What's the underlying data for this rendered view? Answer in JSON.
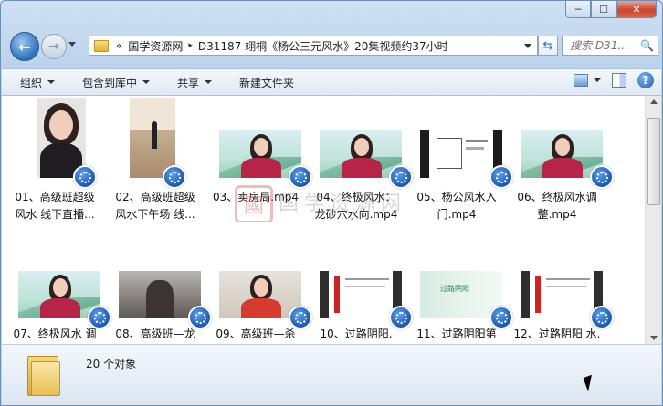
{
  "window": {
    "caption_buttons": {
      "minimize": "─",
      "maximize": "☐",
      "close": "✕"
    }
  },
  "nav": {
    "back_glyph": "←",
    "forward_glyph": "→",
    "breadcrumbs": [
      "«",
      "国学资源网",
      "▸",
      "D31187 翊桐《杨公三元风水》20集视频约37小时"
    ],
    "search_placeholder": "搜索 D31...",
    "search_glyph": "🔍",
    "refresh_glyph": "⇆"
  },
  "toolbar": {
    "organize": "组织",
    "include_library": "包含到库中",
    "share": "共享",
    "new_folder": "新建文件夹",
    "help": "?"
  },
  "files": [
    {
      "label": "01、高级班超级\n风水 线下直播...",
      "thumb": "portrait"
    },
    {
      "label": "02、高级班超级\n风水下午场 线...",
      "thumb": "room"
    },
    {
      "label": "03、卖房局.mp4",
      "thumb": "mountain"
    },
    {
      "label": "04、终极风水：\n龙砂穴水向.mp4",
      "thumb": "mountain"
    },
    {
      "label": "05、杨公风水入\n门.mp4",
      "thumb": "plan"
    },
    {
      "label": "06、终极风水调\n整.mp4",
      "thumb": "mountain"
    },
    {
      "label": "07、终极风水 调",
      "thumb": "mountain2"
    },
    {
      "label": "08、高级班—龙",
      "thumb": "dark"
    },
    {
      "label": "09、高级班—杀",
      "thumb": "red"
    },
    {
      "label": "10、过路阴阳.",
      "thumb": "doc"
    },
    {
      "label": "11、过路阴阳第",
      "thumb": "slide"
    },
    {
      "label": "12、过路阴阳 水.",
      "thumb": "doc"
    }
  ],
  "slide_title": "过路阴阳",
  "status": {
    "count": "20 个对象"
  },
  "watermark": "国学资源网 www.guoxueziyuan.com"
}
